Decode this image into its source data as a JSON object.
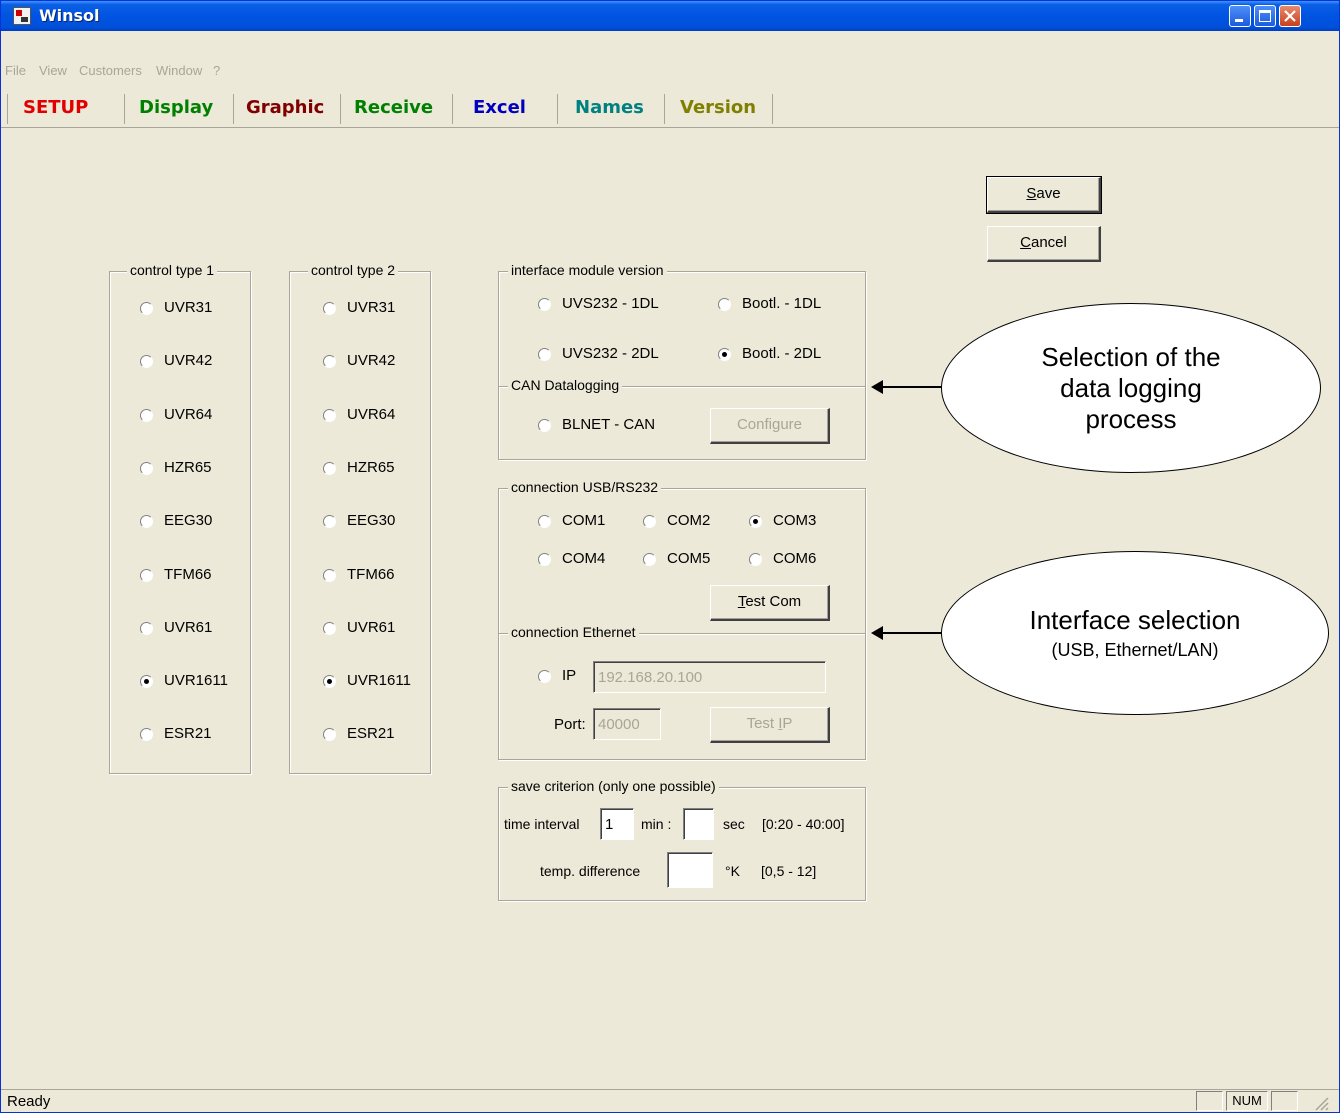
{
  "window": {
    "title": "Winsol"
  },
  "menu": [
    "File",
    "View",
    "Customers",
    "Window",
    "?"
  ],
  "tabs": [
    {
      "label": "SETUP",
      "color": "#e00000"
    },
    {
      "label": "Display",
      "color": "#008000"
    },
    {
      "label": "Graphic",
      "color": "#800000"
    },
    {
      "label": "Receive",
      "color": "#008000"
    },
    {
      "label": "Excel",
      "color": "#0000c0"
    },
    {
      "label": "Names",
      "color": "#008080"
    },
    {
      "label": "Version",
      "color": "#808000"
    }
  ],
  "buttons": {
    "save": "Save",
    "cancel": "Cancel",
    "configure": "Configure",
    "test_com": "Test Com",
    "test_ip": "Test IP"
  },
  "control_type_1": {
    "label": "control type 1",
    "options": [
      "UVR31",
      "UVR42",
      "UVR64",
      "HZR65",
      "EEG30",
      "TFM66",
      "UVR61",
      "UVR1611",
      "ESR21"
    ],
    "selected": "UVR1611"
  },
  "control_type_2": {
    "label": "control type 2",
    "options": [
      "UVR31",
      "UVR42",
      "UVR64",
      "HZR65",
      "EEG30",
      "TFM66",
      "UVR61",
      "UVR1611",
      "ESR21"
    ],
    "selected": "UVR1611"
  },
  "interface_module": {
    "label": "interface module version",
    "options": [
      "UVS232 - 1DL",
      "Bootl. - 1DL",
      "UVS232 - 2DL",
      "Bootl. - 2DL"
    ],
    "selected": "Bootl. - 2DL"
  },
  "can": {
    "label": "CAN Datalogging",
    "option": "BLNET - CAN"
  },
  "usb": {
    "label": "connection USB/RS232",
    "options": [
      "COM1",
      "COM2",
      "COM3",
      "COM4",
      "COM5",
      "COM6"
    ],
    "selected": "COM3"
  },
  "ethernet": {
    "label": "connection Ethernet",
    "ip_label": "IP",
    "ip_value": "192.168.20.100",
    "port_label": "Port:",
    "port_value": "40000"
  },
  "save_criterion": {
    "label": "save criterion (only one possible)",
    "time_label": "time interval",
    "time_min_value": "1",
    "min_label": "min :",
    "sec_label": "sec",
    "time_range": "[0:20 - 40:00]",
    "temp_label": "temp. difference",
    "temp_unit": "°K",
    "temp_range": "[0,5 - 12]"
  },
  "annotations": {
    "logging_callout": [
      "Selection of the",
      "data logging",
      "process"
    ],
    "interface_callout_title": "Interface selection",
    "interface_callout_sub": "(USB, Ethernet/LAN)"
  },
  "status": {
    "text": "Ready",
    "num": "NUM"
  }
}
